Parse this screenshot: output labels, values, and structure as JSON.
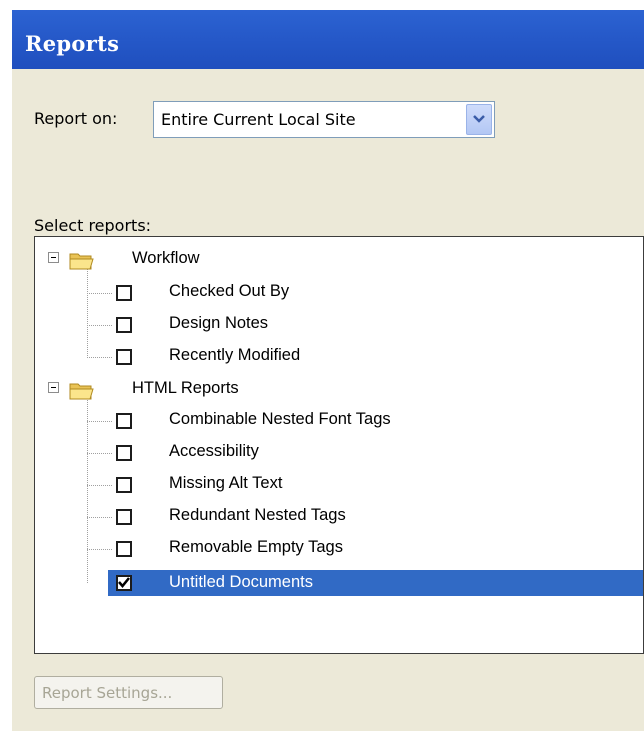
{
  "window": {
    "title": "Reports"
  },
  "report_on": {
    "label": "Report on:",
    "selected": "Entire Current Local Site"
  },
  "select_reports": {
    "label": "Select reports:",
    "groups": [
      {
        "label": "Workflow",
        "expanded": true,
        "items": [
          {
            "label": "Checked Out By",
            "checked": false
          },
          {
            "label": "Design Notes",
            "checked": false
          },
          {
            "label": "Recently Modified",
            "checked": false
          }
        ]
      },
      {
        "label": "HTML Reports",
        "expanded": true,
        "items": [
          {
            "label": "Combinable Nested Font Tags",
            "checked": false
          },
          {
            "label": "Accessibility",
            "checked": false
          },
          {
            "label": "Missing Alt Text",
            "checked": false
          },
          {
            "label": "Redundant Nested Tags",
            "checked": false
          },
          {
            "label": "Removable Empty Tags",
            "checked": false
          },
          {
            "label": "Untitled Documents",
            "checked": true,
            "selected": true
          }
        ]
      }
    ]
  },
  "buttons": {
    "report_settings": "Report Settings..."
  },
  "colors": {
    "titlebar": "#2558c8",
    "selection": "#316ac5",
    "dialog_bg": "#ece9d8"
  }
}
